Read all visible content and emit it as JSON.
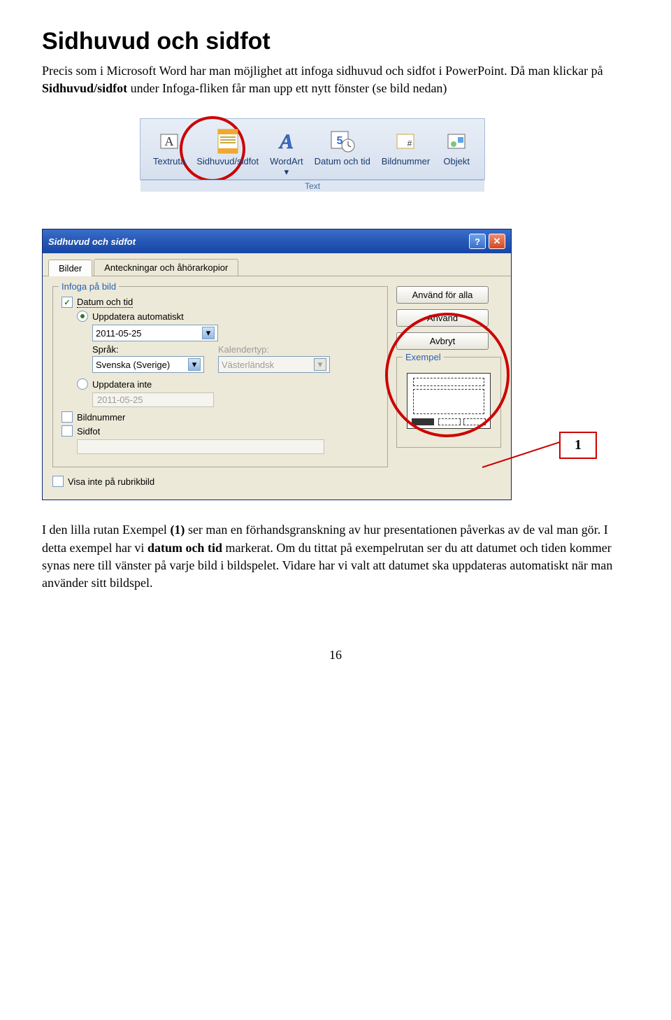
{
  "heading": "Sidhuvud och sidfot",
  "para1_a": "Precis som i Microsoft Word har man möjlighet att infoga sidhuvud och sidfot i PowerPoint. Då man klickar på ",
  "para1_bold": "Sidhuvud/sidfot",
  "para1_b": " under Infoga-fliken får man upp ett nytt fönster (se bild nedan)",
  "ribbon": {
    "textruta": "Textruta",
    "sidhuvud": "Sidhuvud/sidfot",
    "wordart": "WordArt",
    "datumtid": "Datum och tid",
    "bildnummer": "Bildnummer",
    "objekt": "Objekt",
    "group_label": "Text"
  },
  "dialog": {
    "title": "Sidhuvud och sidfot",
    "tab1": "Bilder",
    "tab2": "Anteckningar och åhörarkopior",
    "group_infoga": "Infoga på bild",
    "datum_tid": "Datum och tid",
    "upd_auto": "Uppdatera automatiskt",
    "date_val": "2011-05-25",
    "sprak_lbl": "Språk:",
    "sprak_val": "Svenska (Sverige)",
    "kalender_lbl": "Kalendertyp:",
    "kalender_val": "Västerländsk",
    "upd_inte": "Uppdatera inte",
    "date_val2": "2011-05-25",
    "bildnummer": "Bildnummer",
    "sidfot": "Sidfot",
    "visa_inte": "Visa inte på rubrikbild",
    "btn_alla": "Använd för alla",
    "btn_anv": "Använd",
    "btn_avb": "Avbryt",
    "exempel": "Exempel"
  },
  "callout": "1",
  "para2_a": "I den lilla rutan Exempel ",
  "para2_bold1": "(1)",
  "para2_b": " ser man en förhandsgranskning av hur presentationen påverkas av de val man gör. I detta exempel har vi ",
  "para2_bold2": "datum och tid",
  "para2_c": " markerat. Om du tittat på exempelrutan ser du att datumet och tiden kommer synas nere till vänster på varje bild i bildspelet. Vidare har vi valt att datumet ska uppdateras automatiskt när man använder sitt bildspel.",
  "page_num": "16"
}
